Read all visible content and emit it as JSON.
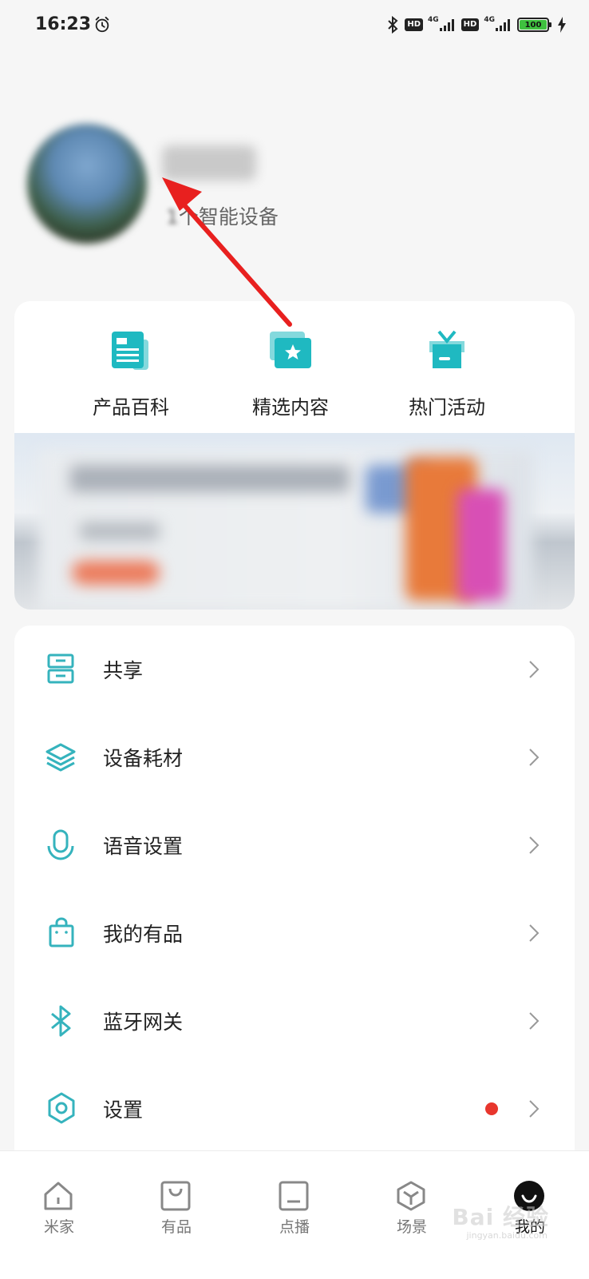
{
  "status_bar": {
    "time": "16:23",
    "hd_1": "HD",
    "signal_1": "4G",
    "hd_2": "HD",
    "signal_2": "4G",
    "battery": "100"
  },
  "profile": {
    "device_count": "1",
    "device_suffix": "个智能设备"
  },
  "quick_actions": [
    {
      "label": "产品百科",
      "icon": "encyclopedia-icon"
    },
    {
      "label": "精选内容",
      "icon": "featured-content-icon"
    },
    {
      "label": "热门活动",
      "icon": "gift-icon"
    }
  ],
  "menu": [
    {
      "label": "共享",
      "icon": "share-icon"
    },
    {
      "label": "设备耗材",
      "icon": "layers-icon"
    },
    {
      "label": "语音设置",
      "icon": "microphone-icon"
    },
    {
      "label": "我的有品",
      "icon": "shopping-bag-icon"
    },
    {
      "label": "蓝牙网关",
      "icon": "bluetooth-icon"
    },
    {
      "label": "设置",
      "icon": "settings-icon",
      "badge": "red-dot"
    }
  ],
  "bottom_nav": [
    {
      "label": "米家",
      "icon": "home-icon"
    },
    {
      "label": "有品",
      "icon": "bag-icon"
    },
    {
      "label": "点播",
      "icon": "tv-icon"
    },
    {
      "label": "场景",
      "icon": "scene-cube-icon"
    },
    {
      "label": "我的",
      "icon": "profile-icon",
      "active": true
    }
  ],
  "watermark": {
    "text": "Bai 经验",
    "sub": "jingyan.baidu.com"
  },
  "colors": {
    "accent": "#1fb9c1",
    "icon_stroke": "#35b3bd",
    "red_dot": "#e8362d",
    "annotation_arrow": "#e8201f"
  }
}
